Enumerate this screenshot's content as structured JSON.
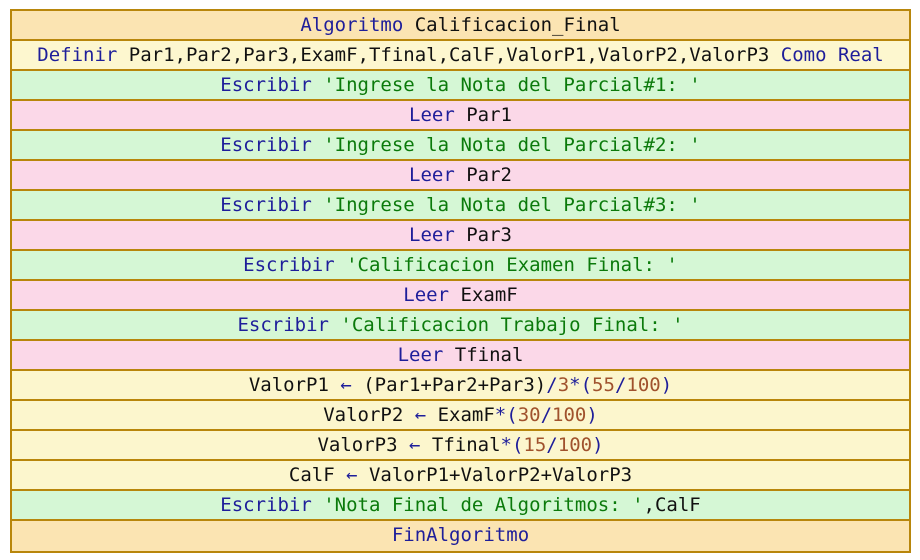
{
  "rows": [
    {
      "type": "header",
      "tokens": [
        [
          "kw",
          "Algoritmo"
        ],
        [
          "id",
          " Calificacion_Final"
        ]
      ]
    },
    {
      "type": "def",
      "tokens": [
        [
          "kw",
          "Definir"
        ],
        [
          "id",
          " Par1,Par2,Par3,ExamF,Tfinal,CalF,ValorP1,ValorP2,ValorP3 "
        ],
        [
          "kw",
          "Como Real"
        ]
      ]
    },
    {
      "type": "write",
      "tokens": [
        [
          "kw",
          "Escribir "
        ],
        [
          "str",
          "'Ingrese la Nota del Parcial#1: '"
        ]
      ]
    },
    {
      "type": "read",
      "tokens": [
        [
          "kw",
          "Leer"
        ],
        [
          "id",
          " Par1"
        ]
      ]
    },
    {
      "type": "write",
      "tokens": [
        [
          "kw",
          "Escribir "
        ],
        [
          "str",
          "'Ingrese la Nota del Parcial#2: '"
        ]
      ]
    },
    {
      "type": "read",
      "tokens": [
        [
          "kw",
          "Leer"
        ],
        [
          "id",
          " Par2"
        ]
      ]
    },
    {
      "type": "write",
      "tokens": [
        [
          "kw",
          "Escribir "
        ],
        [
          "str",
          "'Ingrese la Nota del Parcial#3: '"
        ]
      ]
    },
    {
      "type": "read",
      "tokens": [
        [
          "kw",
          "Leer"
        ],
        [
          "id",
          " Par3"
        ]
      ]
    },
    {
      "type": "write",
      "tokens": [
        [
          "kw",
          "Escribir "
        ],
        [
          "str",
          "'Calificacion Examen Final: '"
        ]
      ]
    },
    {
      "type": "read",
      "tokens": [
        [
          "kw",
          "Leer"
        ],
        [
          "id",
          " ExamF"
        ]
      ]
    },
    {
      "type": "write",
      "tokens": [
        [
          "kw",
          "Escribir "
        ],
        [
          "str",
          "'Calificacion Trabajo Final: '"
        ]
      ]
    },
    {
      "type": "read",
      "tokens": [
        [
          "kw",
          "Leer"
        ],
        [
          "id",
          " Tfinal"
        ]
      ]
    },
    {
      "type": "assign",
      "tokens": [
        [
          "id",
          "ValorP1 "
        ],
        [
          "op",
          "←"
        ],
        [
          "id",
          " (Par1+Par2+Par3)"
        ],
        [
          "op",
          "/"
        ],
        [
          "num",
          "3"
        ],
        [
          "op",
          "*("
        ],
        [
          "num",
          "55"
        ],
        [
          "op",
          "/"
        ],
        [
          "num",
          "100"
        ],
        [
          "op",
          ")"
        ]
      ]
    },
    {
      "type": "assign",
      "tokens": [
        [
          "id",
          "ValorP2 "
        ],
        [
          "op",
          "←"
        ],
        [
          "id",
          " ExamF"
        ],
        [
          "op",
          "*("
        ],
        [
          "num",
          "30"
        ],
        [
          "op",
          "/"
        ],
        [
          "num",
          "100"
        ],
        [
          "op",
          ")"
        ]
      ]
    },
    {
      "type": "assign",
      "tokens": [
        [
          "id",
          "ValorP3 "
        ],
        [
          "op",
          "←"
        ],
        [
          "id",
          " Tfinal"
        ],
        [
          "op",
          "*("
        ],
        [
          "num",
          "15"
        ],
        [
          "op",
          "/"
        ],
        [
          "num",
          "100"
        ],
        [
          "op",
          ")"
        ]
      ]
    },
    {
      "type": "assign",
      "tokens": [
        [
          "id",
          "CalF "
        ],
        [
          "op",
          "←"
        ],
        [
          "id",
          " ValorP1+ValorP2+ValorP3"
        ]
      ]
    },
    {
      "type": "write",
      "tokens": [
        [
          "kw",
          "Escribir "
        ],
        [
          "str",
          "'Nota Final de Algoritmos: '"
        ],
        [
          "id",
          ",CalF"
        ]
      ]
    },
    {
      "type": "header",
      "tokens": [
        [
          "kw",
          "FinAlgoritmo"
        ]
      ]
    }
  ]
}
